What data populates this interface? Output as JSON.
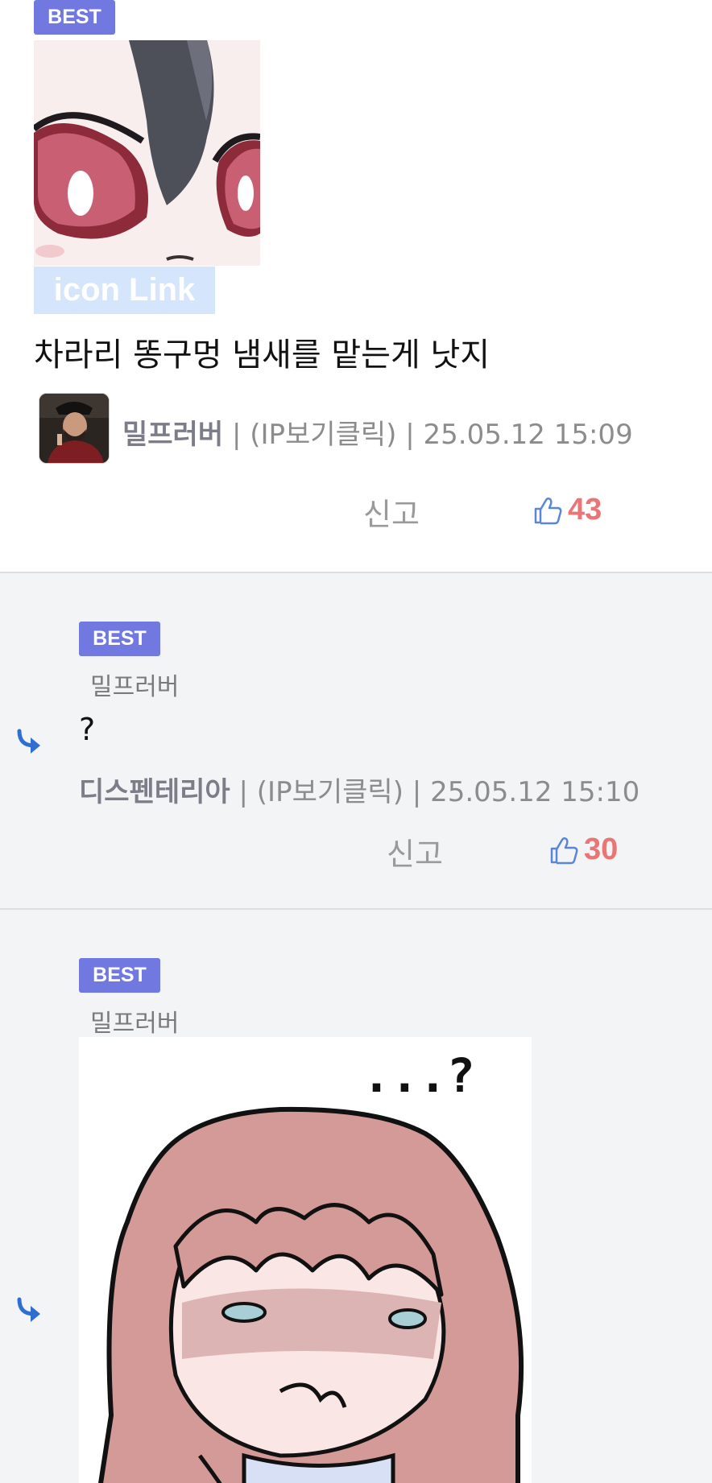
{
  "main_comment": {
    "badge": "BEST",
    "icon_link_label": "icon Link",
    "text": "차라리 똥구멍 냄새를 맡는게 낫지",
    "author": "밀프러버",
    "ip_label": "(IP보기클릭)",
    "separator": "|",
    "timestamp": "25.05.12 15:09",
    "report_label": "신고",
    "likes": "43"
  },
  "replies": [
    {
      "badge": "BEST",
      "reply_to": "밀프러버",
      "text": "?",
      "author": "디스펜테리아",
      "ip_label": "(IP보기클릭)",
      "separator": "|",
      "timestamp": "25.05.12 15:10",
      "report_label": "신고",
      "likes": "30"
    },
    {
      "badge": "BEST",
      "reply_to": "밀프러버",
      "image_text": "...?"
    }
  ],
  "icons": {
    "reply": "reply-arrow-icon",
    "like": "thumbs-up-icon"
  },
  "colors": {
    "badge": "#7179e0",
    "likes": "#ea7575",
    "reply_arrow": "#2f6fd1",
    "reply_bg": "#f3f4f6"
  }
}
